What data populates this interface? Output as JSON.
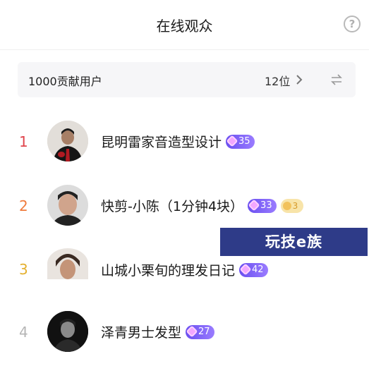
{
  "header": {
    "title": "在线观众",
    "help_icon": "question-circle-icon",
    "help_glyph": "?"
  },
  "contributors": {
    "label": "1000贡献用户",
    "count": "12位",
    "chevron_icon": "chevron-right-icon",
    "swap_icon": "swap-icon"
  },
  "users": [
    {
      "rank": "1",
      "rank_color": "#e0454d",
      "name": "昆明雷家音造型设计",
      "level": "35"
    },
    {
      "rank": "2",
      "rank_color": "#ef7a3b",
      "name": "快剪-小陈（1分钟4块）",
      "level": "33",
      "extra_badge": "3"
    },
    {
      "rank": "3",
      "rank_color": "#e4b02e",
      "name": "山城小栗旬的理发日记",
      "level": "42"
    },
    {
      "rank": "4",
      "rank_color": "#b5b5b5",
      "name": "泽青男士发型",
      "level": "27"
    }
  ],
  "watermark": {
    "text": "玩技e族"
  }
}
